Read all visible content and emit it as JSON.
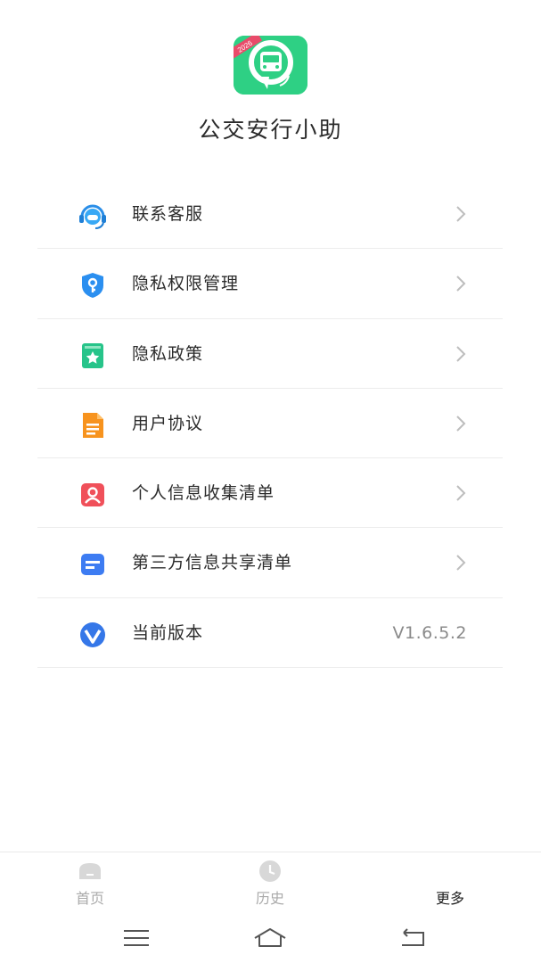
{
  "app": {
    "title": "公交安行小助",
    "logo_badge": "2026",
    "brand_color": "#2ed084"
  },
  "menu": [
    {
      "label": "联系客服",
      "icon": "customer-service-icon",
      "chevron": true
    },
    {
      "label": "隐私权限管理",
      "icon": "shield-key-icon",
      "chevron": true
    },
    {
      "label": "隐私政策",
      "icon": "bookmark-star-icon",
      "chevron": true
    },
    {
      "label": "用户协议",
      "icon": "document-icon",
      "chevron": true
    },
    {
      "label": "个人信息收集清单",
      "icon": "person-card-icon",
      "chevron": true
    },
    {
      "label": "第三方信息共享清单",
      "icon": "list-card-icon",
      "chevron": true
    },
    {
      "label": "当前版本",
      "icon": "version-v-icon",
      "value": "V1.6.5.2"
    }
  ],
  "tabs": [
    {
      "label": "首页",
      "icon": "home-icon",
      "active": false
    },
    {
      "label": "历史",
      "icon": "clock-icon",
      "active": false
    },
    {
      "label": "更多",
      "icon": "",
      "active": true
    }
  ],
  "system_nav": [
    "menu-icon",
    "home-icon",
    "back-icon"
  ]
}
